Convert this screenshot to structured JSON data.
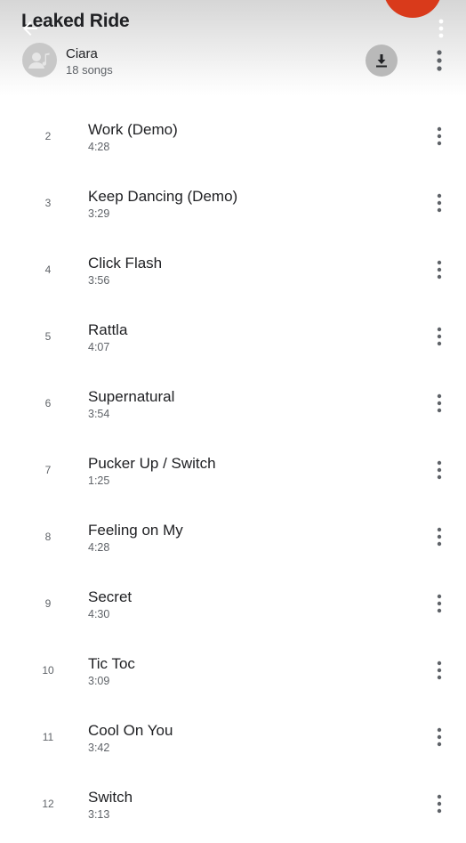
{
  "header": {
    "title": "Leaked Ride",
    "artist": "Ciara",
    "song_count": "18 songs",
    "back_icon": "arrow-back-icon",
    "download_icon": "download-icon",
    "more_icon": "more-vert-icon"
  },
  "colors": {
    "fab": "#d93a1b",
    "text_primary": "#202124",
    "text_secondary": "#5f6368"
  },
  "songs": [
    {
      "number": "2",
      "title": "Work (Demo)",
      "duration": "4:28"
    },
    {
      "number": "3",
      "title": "Keep Dancing (Demo)",
      "duration": "3:29"
    },
    {
      "number": "4",
      "title": "Click Flash",
      "duration": "3:56"
    },
    {
      "number": "5",
      "title": "Rattla",
      "duration": "4:07"
    },
    {
      "number": "6",
      "title": "Supernatural",
      "duration": "3:54"
    },
    {
      "number": "7",
      "title": "Pucker Up / Switch",
      "duration": "1:25"
    },
    {
      "number": "8",
      "title": "Feeling on My",
      "duration": "4:28"
    },
    {
      "number": "9",
      "title": "Secret",
      "duration": "4:30"
    },
    {
      "number": "10",
      "title": "Tic Toc",
      "duration": "3:09"
    },
    {
      "number": "11",
      "title": "Cool On You",
      "duration": "3:42"
    },
    {
      "number": "12",
      "title": "Switch",
      "duration": "3:13"
    }
  ]
}
